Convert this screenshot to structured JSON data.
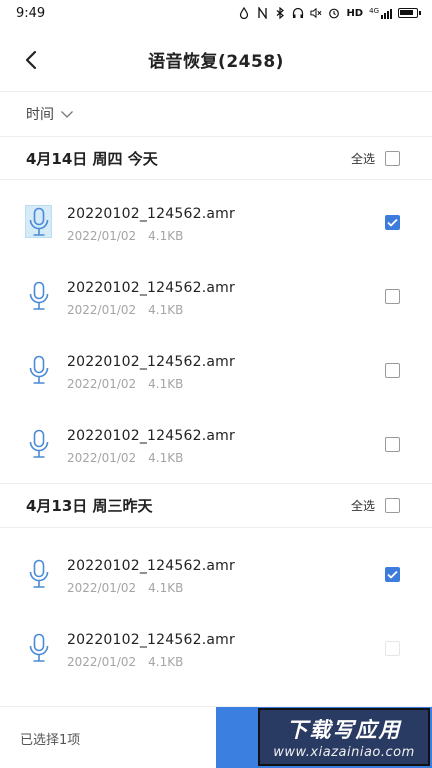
{
  "status_bar": {
    "time": "9:49",
    "network_label": "HD",
    "signal_label": "4G"
  },
  "nav": {
    "title": "语音恢复(2458)"
  },
  "filter": {
    "label": "时间"
  },
  "groups": [
    {
      "title": "4月14日 周四 今天",
      "select_all_label": "全选",
      "items": [
        {
          "name": "20220102_124562.amr",
          "date": "2022/01/02",
          "size": "4.1KB",
          "checked": true
        },
        {
          "name": "20220102_124562.amr",
          "date": "2022/01/02",
          "size": "4.1KB",
          "checked": false
        },
        {
          "name": "20220102_124562.amr",
          "date": "2022/01/02",
          "size": "4.1KB",
          "checked": false
        },
        {
          "name": "20220102_124562.amr",
          "date": "2022/01/02",
          "size": "4.1KB",
          "checked": false
        }
      ]
    },
    {
      "title": "4月13日 周三昨天",
      "select_all_label": "全选",
      "items": [
        {
          "name": "20220102_124562.amr",
          "date": "2022/01/02",
          "size": "4.1KB",
          "checked": true
        },
        {
          "name": "20220102_124562.amr",
          "date": "2022/01/02",
          "size": "4.1KB",
          "checked": false
        }
      ]
    }
  ],
  "bottom_bar": {
    "selected_text": "已选择1项"
  },
  "watermark": {
    "title": "下载写应用",
    "url": "www.xiazainiao.com"
  },
  "colors": {
    "accent": "#3b7fe1",
    "icon": "#4a8ad6",
    "meta_text": "#a5a5a5"
  }
}
